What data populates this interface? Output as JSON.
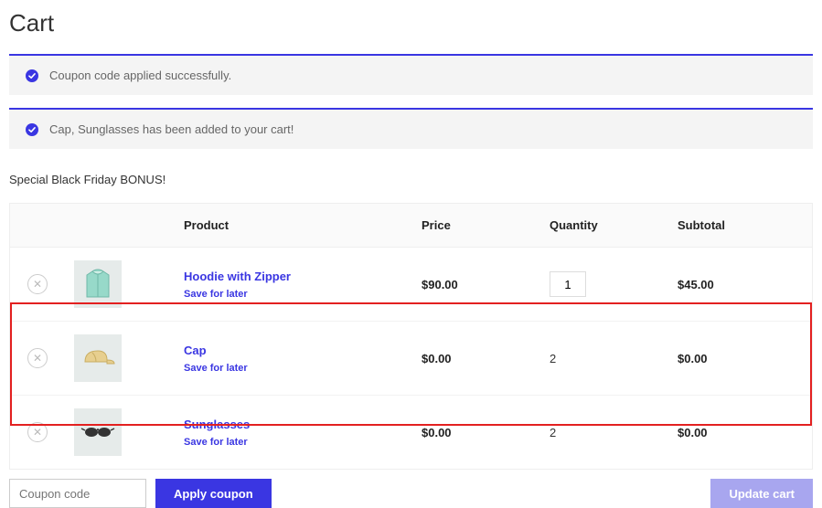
{
  "page": {
    "title": "Cart"
  },
  "alerts": {
    "coupon": "Coupon code applied successfully.",
    "added": "Cap, Sunglasses has been added to your cart!"
  },
  "bonus_text": "Special Black Friday BONUS!",
  "table": {
    "headers": {
      "product": "Product",
      "price": "Price",
      "qty": "Quantity",
      "subtotal": "Subtotal"
    },
    "save_label": "Save for later",
    "items": [
      {
        "name": "Hoodie with Zipper",
        "price": "$90.00",
        "qty": "1",
        "qty_editable": true,
        "subtotal": "$45.00"
      },
      {
        "name": "Cap",
        "price": "$0.00",
        "qty": "2",
        "qty_editable": false,
        "subtotal": "$0.00"
      },
      {
        "name": "Sunglasses",
        "price": "$0.00",
        "qty": "2",
        "qty_editable": false,
        "subtotal": "$0.00"
      }
    ]
  },
  "actions": {
    "coupon_placeholder": "Coupon code",
    "apply_label": "Apply coupon",
    "update_label": "Update cart"
  }
}
